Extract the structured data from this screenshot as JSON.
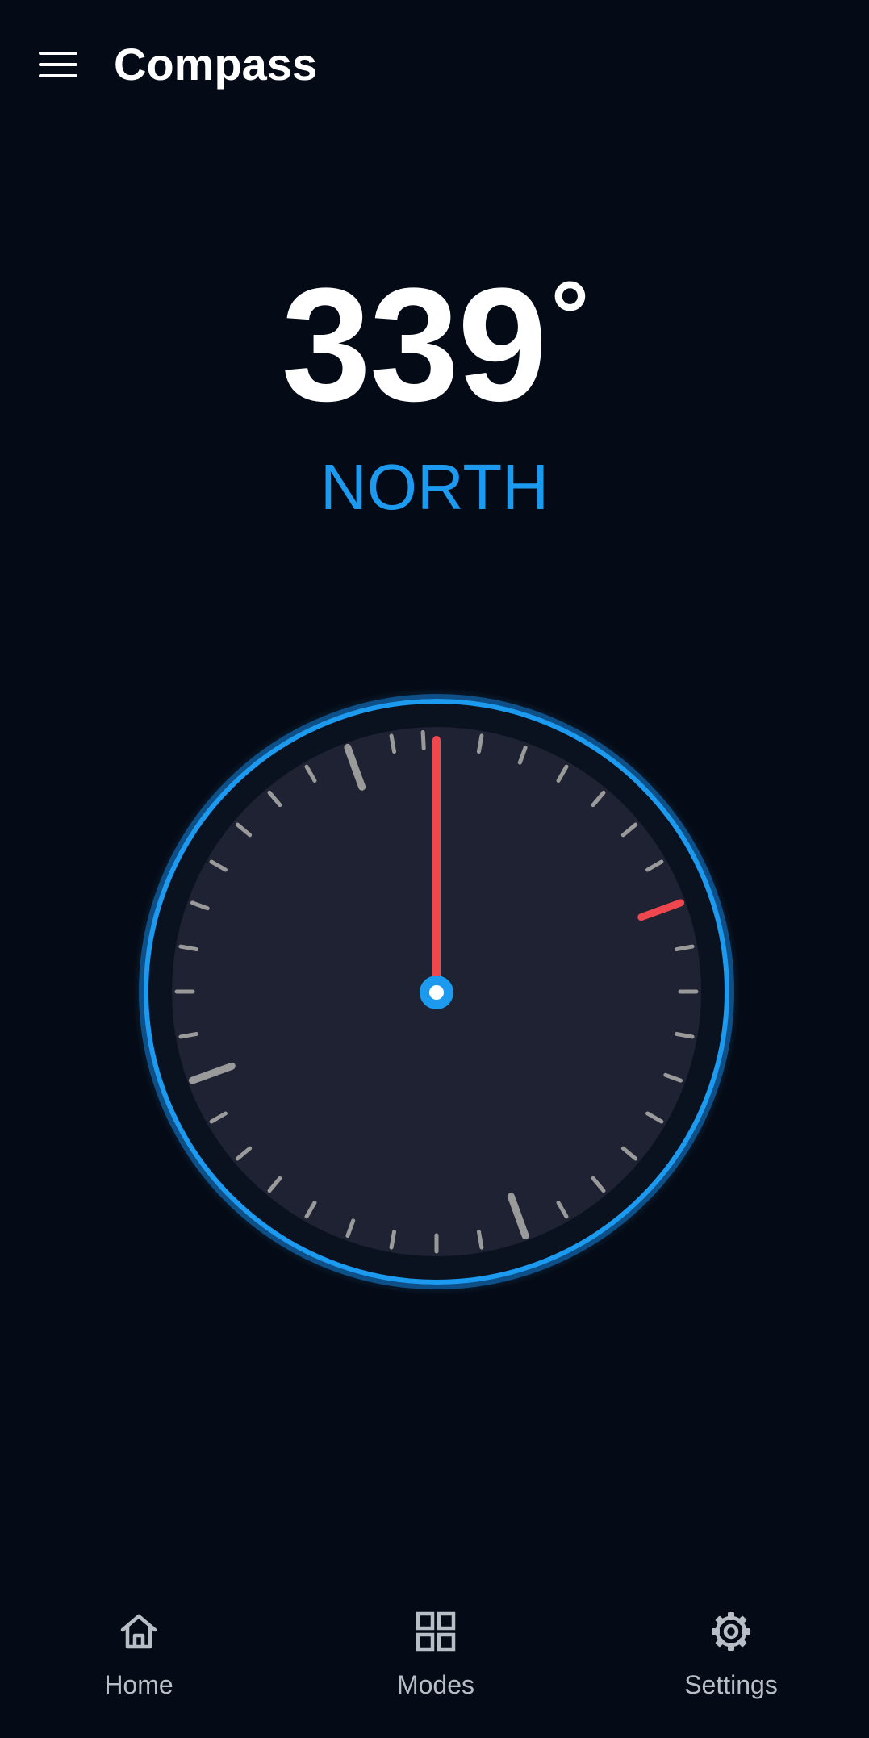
{
  "app_bar": {
    "title": "Compass",
    "menu_icon": "hamburger-menu-icon"
  },
  "heading": {
    "value": "339",
    "degree_symbol": "°",
    "direction": "NORTH",
    "degrees": 339
  },
  "compass": {
    "needle_angle_deg": 0,
    "red_mark_angle_deg": 70
  },
  "bottom_nav": {
    "items": [
      {
        "label": "Home",
        "icon": "home-icon"
      },
      {
        "label": "Modes",
        "icon": "grid-icon"
      },
      {
        "label": "Settings",
        "icon": "gear-icon"
      }
    ]
  },
  "colors": {
    "background": "#050b16",
    "dial_face": "#1e2233",
    "accent_blue": "#1b9af0",
    "needle_red": "#f0474e",
    "tick_gray": "#9a9a9a",
    "nav_gray": "#b9bec6"
  }
}
